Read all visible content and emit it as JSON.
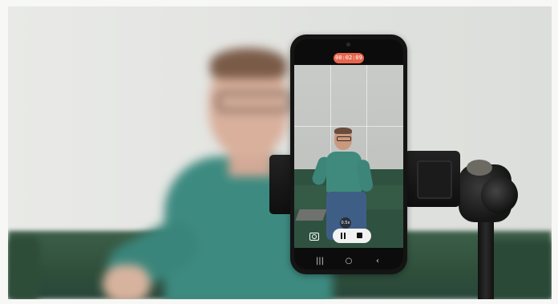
{
  "recording": {
    "timer_text": "00:02:09",
    "timer_color": "#e8654d",
    "zoom_label": "0.5x"
  },
  "controls": {
    "switch_camera_icon": "camera-switch-icon",
    "pause_icon": "pause-icon",
    "stop_icon": "stop-icon"
  },
  "nav": {
    "recents_glyph": "|||",
    "home_glyph": "○",
    "back_glyph": "‹"
  },
  "colors": {
    "shirt": "#3d8a80",
    "sofa": "#2f4f3b",
    "wall": "#e4e5e2"
  }
}
